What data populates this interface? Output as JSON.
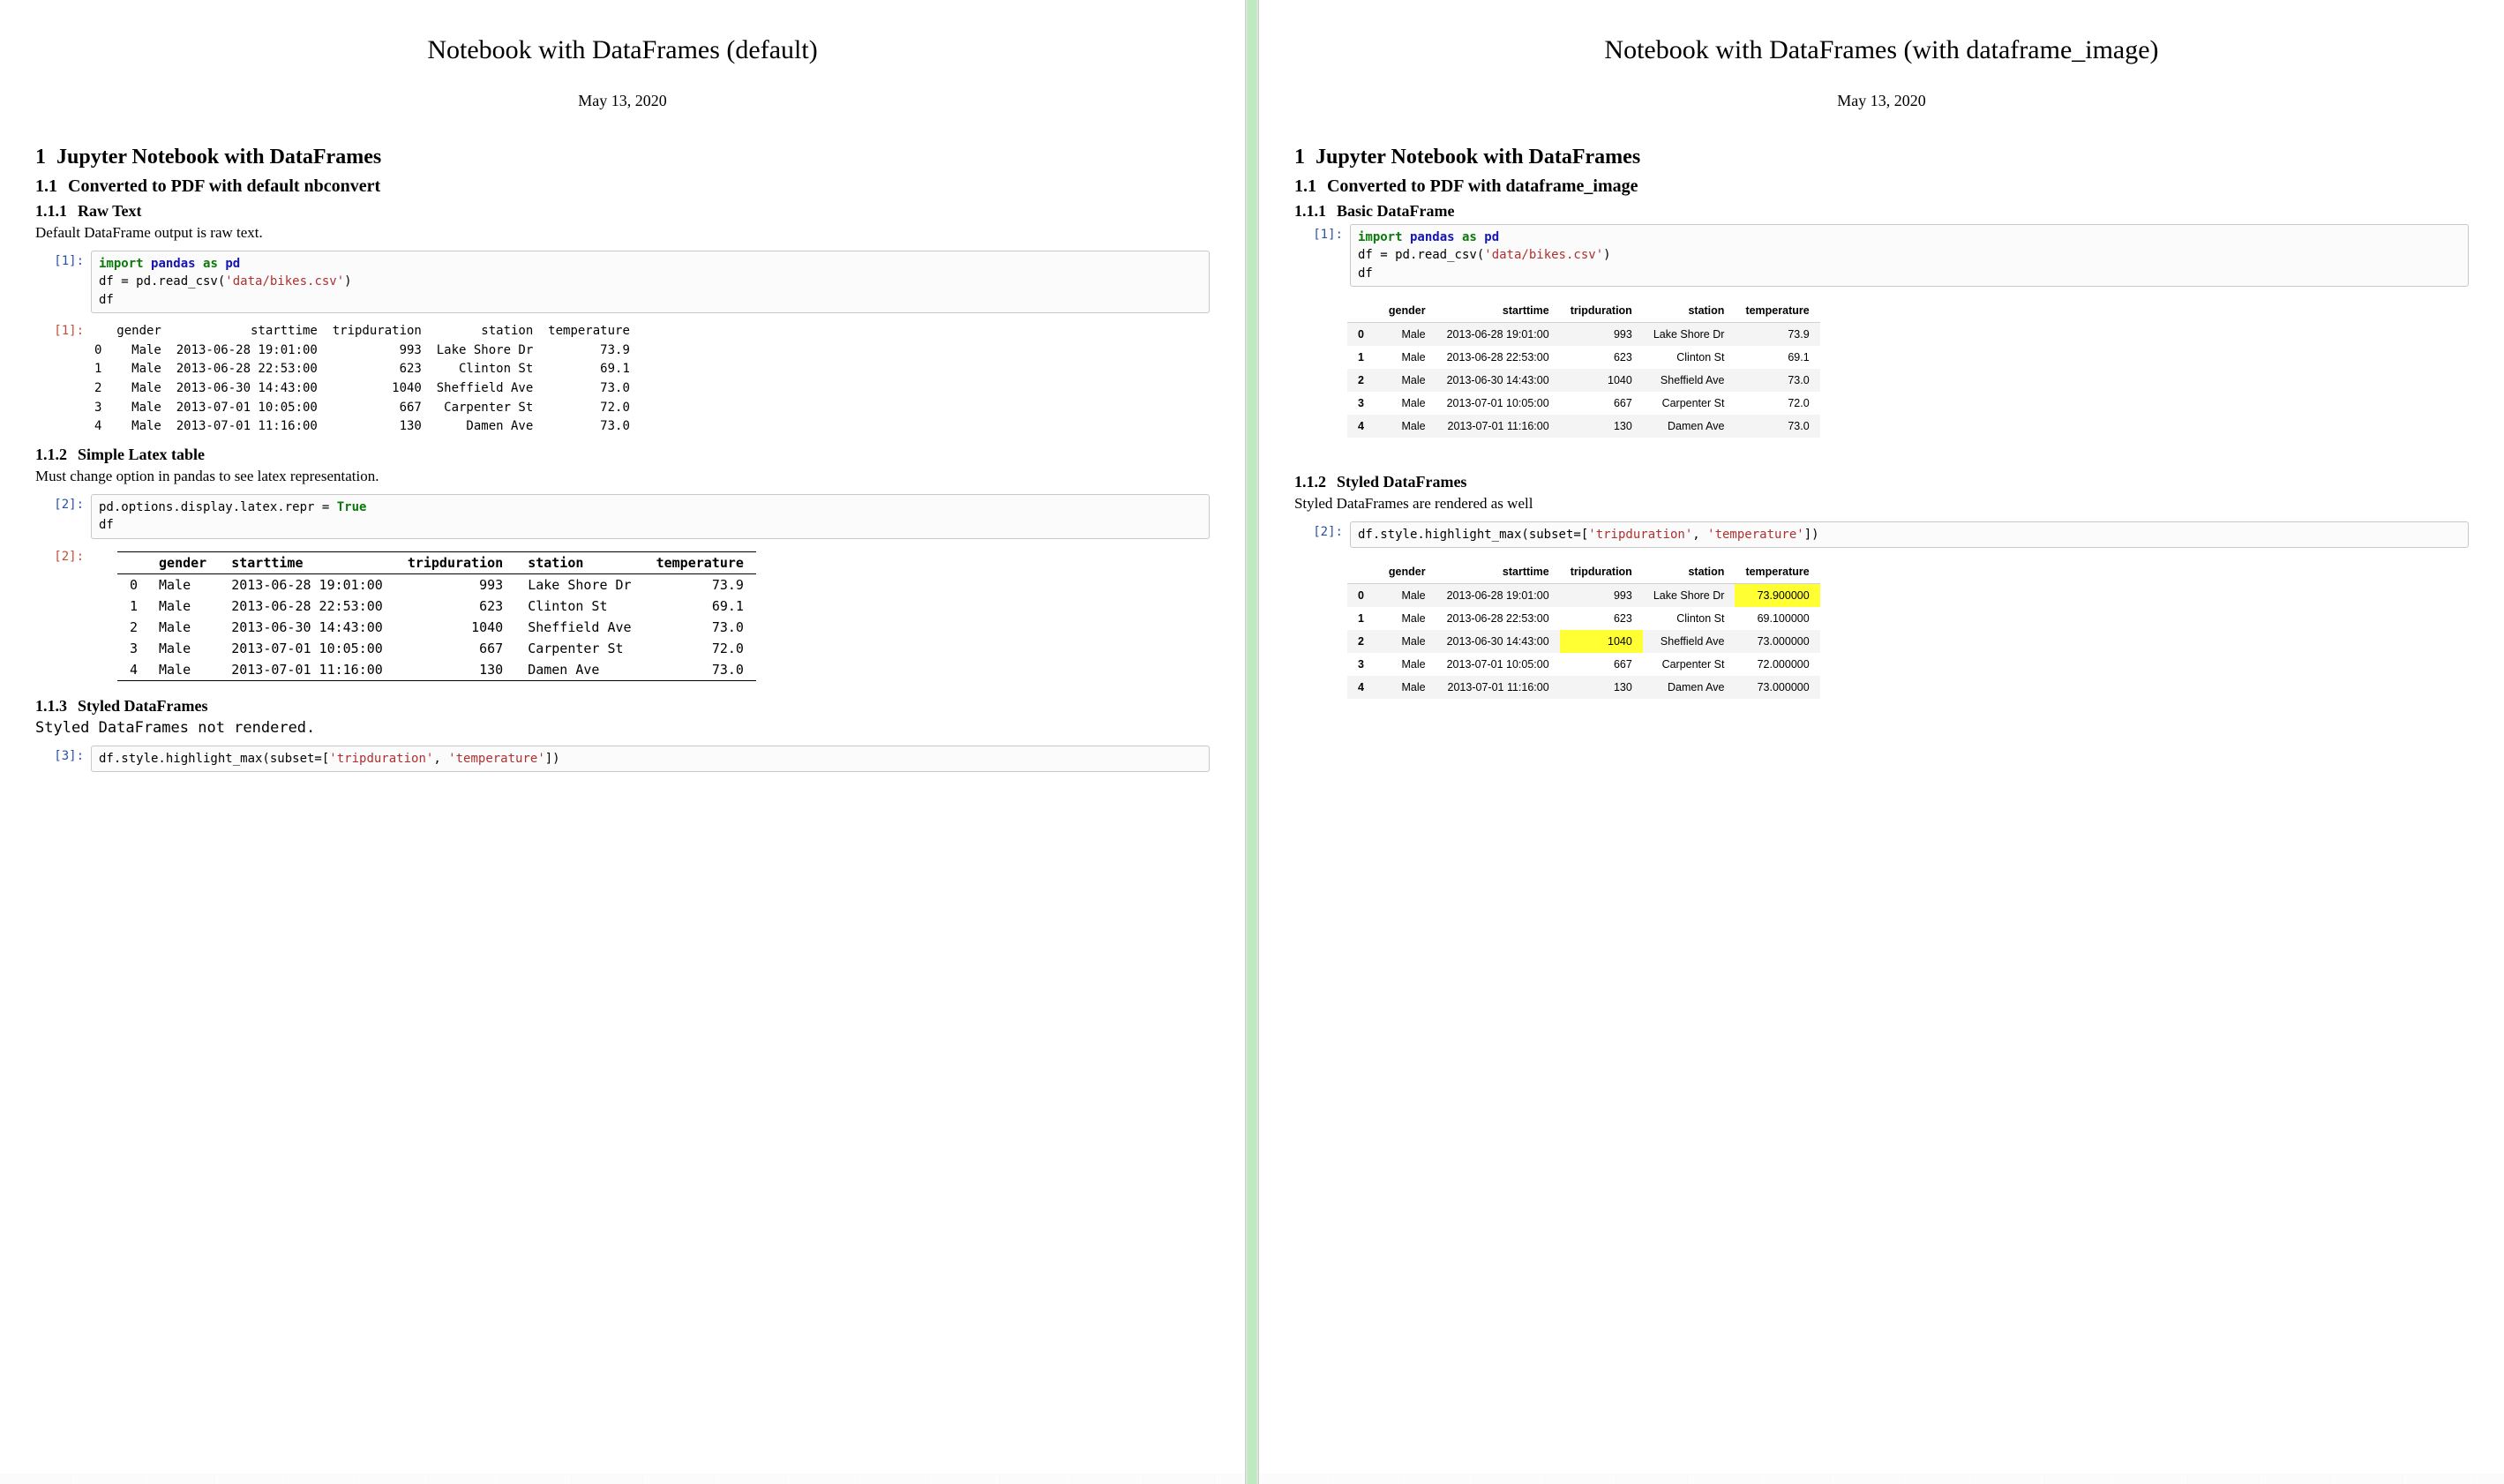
{
  "left": {
    "title": "Notebook with DataFrames (default)",
    "date": "May 13, 2020",
    "h1_num": "1",
    "h1": "Jupyter Notebook with DataFrames",
    "h2_num": "1.1",
    "h2": "Converted to PDF with default nbconvert",
    "s111_num": "1.1.1",
    "s111": "Raw Text",
    "s111_text": "Default DataFrame output is raw text.",
    "in1_prompt": "[1]:",
    "out1_prompt": "[1]:",
    "code1": {
      "l1a": "import",
      "l1b": "pandas",
      "l1c": "as",
      "l1d": "pd",
      "l2a": "df = pd.read_csv(",
      "l2b": "'data/bikes.csv'",
      "l2c": ")",
      "l3": "df"
    },
    "out1_text": "   gender            starttime  tripduration        station  temperature\n0    Male  2013-06-28 19:01:00           993  Lake Shore Dr         73.9\n1    Male  2013-06-28 22:53:00           623     Clinton St         69.1\n2    Male  2013-06-30 14:43:00          1040  Sheffield Ave         73.0\n3    Male  2013-07-01 10:05:00           667   Carpenter St         72.0\n4    Male  2013-07-01 11:16:00           130      Damen Ave         73.0",
    "s112_num": "1.1.2",
    "s112": "Simple Latex table",
    "s112_text": "Must change option in pandas to see latex representation.",
    "in2_prompt": "[2]:",
    "out2_prompt": "[2]:",
    "code2": {
      "l1a": "pd.options.display.latex.repr = ",
      "l1b": "True",
      "l2": "df"
    },
    "table2_headers": [
      "",
      "gender",
      "starttime",
      "tripduration",
      "station",
      "temperature"
    ],
    "table2_rows": [
      [
        "0",
        "Male",
        "2013-06-28 19:01:00",
        "993",
        "Lake Shore Dr",
        "73.9"
      ],
      [
        "1",
        "Male",
        "2013-06-28 22:53:00",
        "623",
        "Clinton St",
        "69.1"
      ],
      [
        "2",
        "Male",
        "2013-06-30 14:43:00",
        "1040",
        "Sheffield Ave",
        "73.0"
      ],
      [
        "3",
        "Male",
        "2013-07-01 10:05:00",
        "667",
        "Carpenter St",
        "72.0"
      ],
      [
        "4",
        "Male",
        "2013-07-01 11:16:00",
        "130",
        "Damen Ave",
        "73.0"
      ]
    ],
    "s113_num": "1.1.3",
    "s113": "Styled DataFrames",
    "s113_text": "Styled DataFrames not rendered.",
    "in3_prompt": "[3]:",
    "code3": {
      "a": "df.style.highlight_max(subset=[",
      "b": "'tripduration'",
      "c": ", ",
      "d": "'temperature'",
      "e": "])"
    }
  },
  "right": {
    "title": "Notebook with DataFrames (with dataframe_image)",
    "date": "May 13, 2020",
    "h1_num": "1",
    "h1": "Jupyter Notebook with DataFrames",
    "h2_num": "1.1",
    "h2": "Converted to PDF with dataframe_image",
    "s111_num": "1.1.1",
    "s111": "Basic DataFrame",
    "in1_prompt": "[1]:",
    "code1": {
      "l1a": "import",
      "l1b": "pandas",
      "l1c": "as",
      "l1d": "pd",
      "l2a": "df = pd.read_csv(",
      "l2b": "'data/bikes.csv'",
      "l2c": ")",
      "l3": "df"
    },
    "df_headers": [
      "",
      "gender",
      "starttime",
      "tripduration",
      "station",
      "temperature"
    ],
    "df_rows": [
      [
        "0",
        "Male",
        "2013-06-28 19:01:00",
        "993",
        "Lake Shore Dr",
        "73.9"
      ],
      [
        "1",
        "Male",
        "2013-06-28 22:53:00",
        "623",
        "Clinton St",
        "69.1"
      ],
      [
        "2",
        "Male",
        "2013-06-30 14:43:00",
        "1040",
        "Sheffield Ave",
        "73.0"
      ],
      [
        "3",
        "Male",
        "2013-07-01 10:05:00",
        "667",
        "Carpenter St",
        "72.0"
      ],
      [
        "4",
        "Male",
        "2013-07-01 11:16:00",
        "130",
        "Damen Ave",
        "73.0"
      ]
    ],
    "s112_num": "1.1.2",
    "s112": "Styled DataFrames",
    "s112_text": "Styled DataFrames are rendered as well",
    "in2_prompt": "[2]:",
    "code2": {
      "a": "df.style.highlight_max(subset=[",
      "b": "'tripduration'",
      "c": ", ",
      "d": "'temperature'",
      "e": "])"
    },
    "styled_headers": [
      "",
      "gender",
      "starttime",
      "tripduration",
      "station",
      "temperature"
    ],
    "styled_rows": [
      {
        "idx": "0",
        "gender": "Male",
        "starttime": "2013-06-28 19:01:00",
        "tripduration": "993",
        "station": "Lake Shore Dr",
        "temperature": "73.900000",
        "hl_trip": false,
        "hl_temp": true
      },
      {
        "idx": "1",
        "gender": "Male",
        "starttime": "2013-06-28 22:53:00",
        "tripduration": "623",
        "station": "Clinton St",
        "temperature": "69.100000",
        "hl_trip": false,
        "hl_temp": false
      },
      {
        "idx": "2",
        "gender": "Male",
        "starttime": "2013-06-30 14:43:00",
        "tripduration": "1040",
        "station": "Sheffield Ave",
        "temperature": "73.000000",
        "hl_trip": true,
        "hl_temp": false
      },
      {
        "idx": "3",
        "gender": "Male",
        "starttime": "2013-07-01 10:05:00",
        "tripduration": "667",
        "station": "Carpenter St",
        "temperature": "72.000000",
        "hl_trip": false,
        "hl_temp": false
      },
      {
        "idx": "4",
        "gender": "Male",
        "starttime": "2013-07-01 11:16:00",
        "tripduration": "130",
        "station": "Damen Ave",
        "temperature": "73.000000",
        "hl_trip": false,
        "hl_temp": false
      }
    ]
  }
}
